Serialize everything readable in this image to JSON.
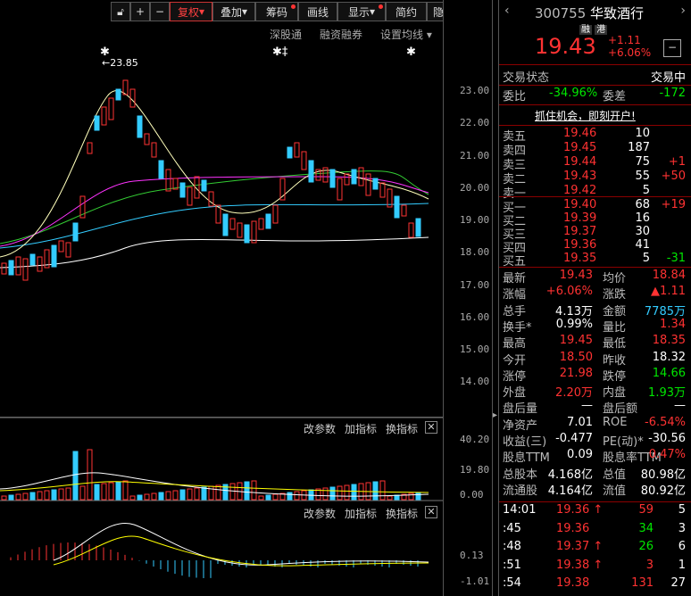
{
  "toolbar": {
    "fuquan": "复权",
    "diejia": "叠加",
    "chouma": "筹码",
    "huaxian": "画线",
    "xianshi": "显示",
    "jianyue": "简约",
    "yincang": "隐藏"
  },
  "subbar": {
    "sgt": "深股通",
    "rzrq": "融资融券",
    "setma": "设置均线"
  },
  "chart": {
    "max_label": "23.85",
    "price_ticks": [
      "23.00",
      "22.00",
      "21.00",
      "20.00",
      "19.00",
      "18.00",
      "17.00",
      "16.00",
      "15.00",
      "14.00"
    ],
    "vol_ticks": [
      "40.20",
      "19.80",
      "0.00"
    ],
    "macd_ticks": [
      "0.13",
      "-1.01"
    ],
    "ind1": {
      "gcs": "改参数",
      "jzb": "加指标",
      "hzb": "换指标"
    },
    "ind2": {
      "gcs": "改参数",
      "jzb": "加指标",
      "hzb": "换指标"
    }
  },
  "quote": {
    "code": "300755",
    "name": "华致酒行",
    "tag1": "融",
    "tag2": "港",
    "price": "19.43",
    "change": "+1.11",
    "pct": "+6.06%"
  },
  "status": {
    "label": "交易状态",
    "value": "交易中",
    "wb_l": "委比",
    "wb_v": "-34.96%",
    "wc_l": "委差",
    "wc_v": "-172",
    "ad": "抓住机会，即刻开户!"
  },
  "asks": [
    {
      "l": "卖五",
      "p": "19.46",
      "v": "10",
      "c": ""
    },
    {
      "l": "卖四",
      "p": "19.45",
      "v": "187",
      "c": ""
    },
    {
      "l": "卖三",
      "p": "19.44",
      "v": "75",
      "c": "+1"
    },
    {
      "l": "卖二",
      "p": "19.43",
      "v": "55",
      "c": "+50"
    },
    {
      "l": "卖一",
      "p": "19.42",
      "v": "5",
      "c": ""
    }
  ],
  "bids": [
    {
      "l": "买一",
      "p": "19.40",
      "v": "68",
      "c": "+19"
    },
    {
      "l": "买二",
      "p": "19.39",
      "v": "16",
      "c": ""
    },
    {
      "l": "买三",
      "p": "19.37",
      "v": "30",
      "c": ""
    },
    {
      "l": "买四",
      "p": "19.36",
      "v": "41",
      "c": ""
    },
    {
      "l": "买五",
      "p": "19.35",
      "v": "5",
      "c": "-31"
    }
  ],
  "stats": [
    {
      "a": "最新",
      "b": "19.43",
      "c": "均价",
      "d": "18.84"
    },
    {
      "a": "涨幅",
      "b": "+6.06%",
      "c": "涨跌",
      "d": "▲1.11"
    },
    {
      "a": "总手",
      "b": "4.13万",
      "c": "金额",
      "d": "7785万"
    },
    {
      "a": "换手*",
      "b": "0.99%",
      "c": "量比",
      "d": "1.34"
    },
    {
      "a": "最高",
      "b": "19.45",
      "c": "最低",
      "d": "18.35"
    },
    {
      "a": "今开",
      "b": "18.50",
      "c": "昨收",
      "d": "18.32"
    },
    {
      "a": "涨停",
      "b": "21.98",
      "c": "跌停",
      "d": "14.66"
    },
    {
      "a": "外盘",
      "b": "2.20万",
      "c": "内盘",
      "d": "1.93万"
    },
    {
      "a": "盘后量",
      "b": "—",
      "c": "盘后额",
      "d": "—"
    },
    {
      "a": "净资产",
      "b": "7.01",
      "c": "ROE",
      "d": "-6.54%"
    },
    {
      "a": "收益(三)",
      "b": "-0.477",
      "c": "PE(动)*",
      "d": "-30.56"
    },
    {
      "a": "股息TTM",
      "b": "0.09",
      "c": "股息率TTM",
      "d": "0.47%"
    },
    {
      "a": "总股本",
      "b": "4.168亿",
      "c": "总值",
      "d": "80.98亿"
    },
    {
      "a": "流通股",
      "b": "4.164亿",
      "c": "流值",
      "d": "80.92亿"
    }
  ],
  "ticks": [
    {
      "t": "14:01",
      "p": "19.36",
      "ar": "↑",
      "v": "59",
      "n": "5"
    },
    {
      "t": ":45",
      "p": "19.36",
      "ar": "",
      "v": "34",
      "n": "3"
    },
    {
      "t": ":48",
      "p": "19.37",
      "ar": "↑",
      "v": "26",
      "n": "6"
    },
    {
      "t": ":51",
      "p": "19.38",
      "ar": "↑",
      "v": "3",
      "n": "1"
    },
    {
      "t": ":54",
      "p": "19.38",
      "ar": "",
      "v": "131",
      "n": "27"
    }
  ]
}
